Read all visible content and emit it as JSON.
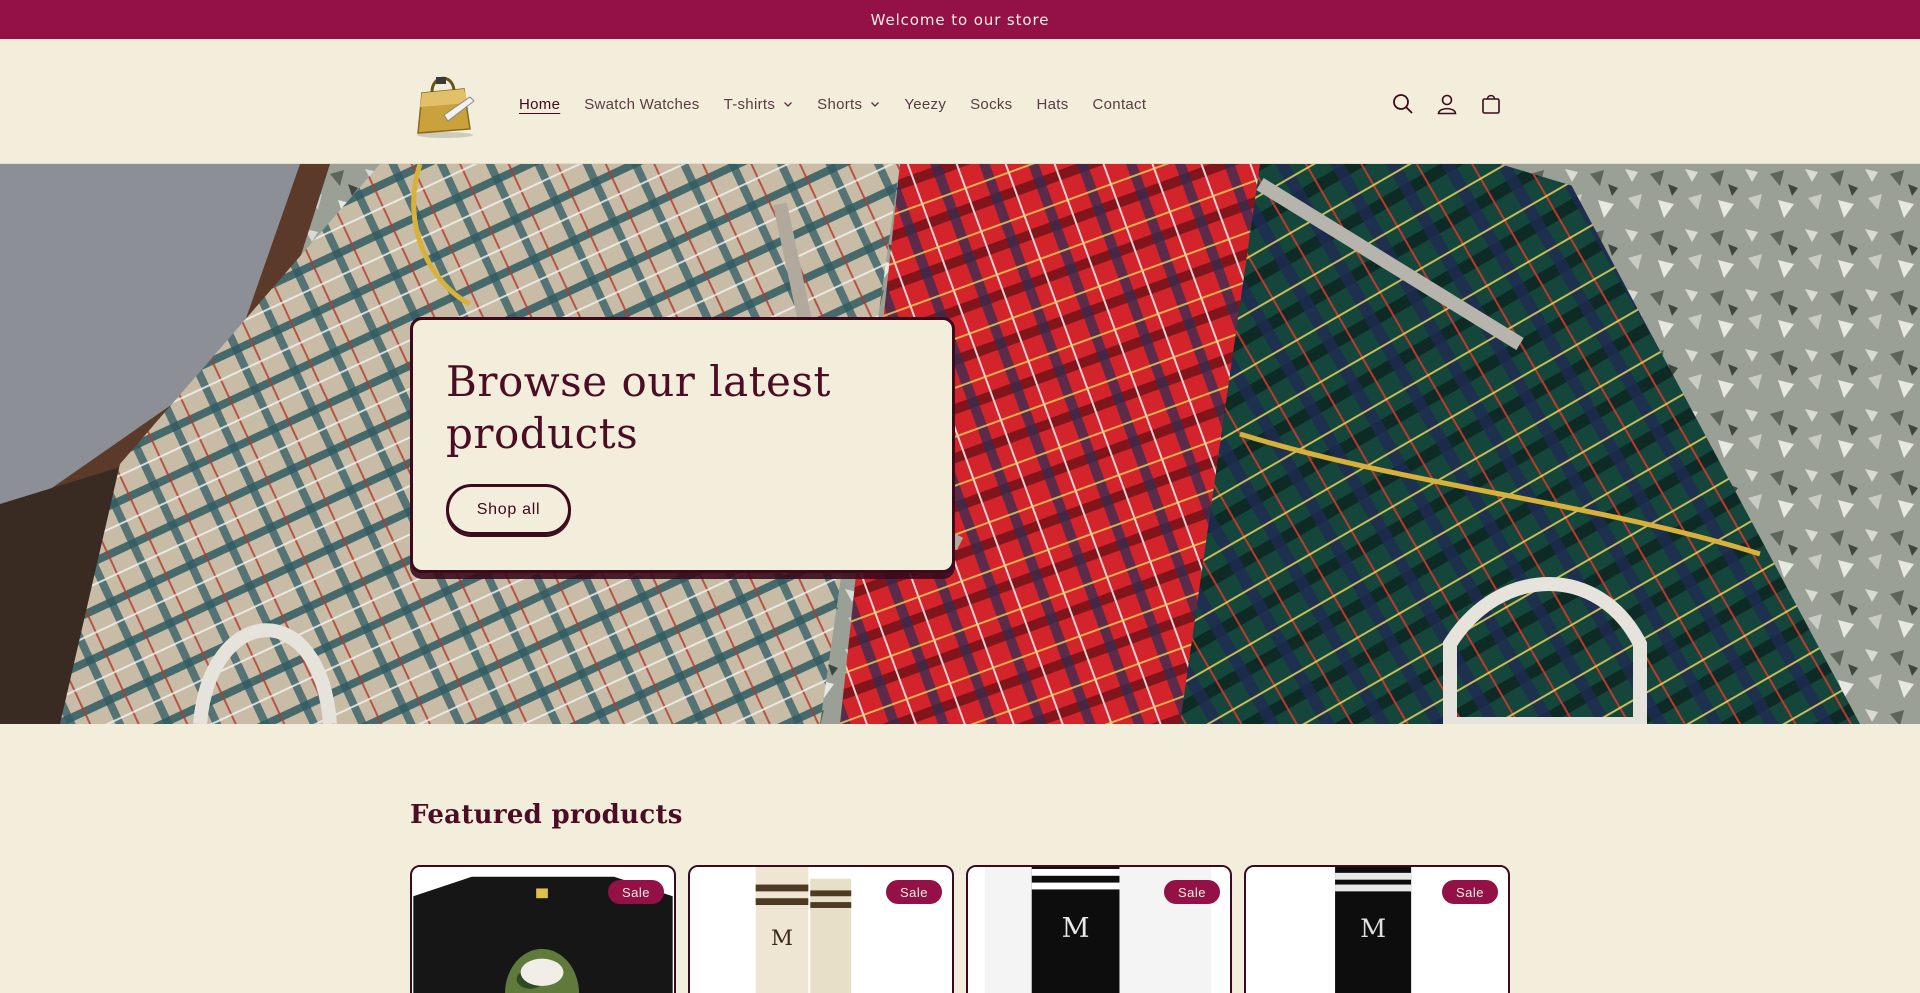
{
  "announcement": {
    "text": "Welcome to our store"
  },
  "header": {
    "nav": [
      {
        "label": "Home",
        "active": true,
        "dropdown": false
      },
      {
        "label": "Swatch Watches",
        "active": false,
        "dropdown": false
      },
      {
        "label": "T-shirts",
        "active": false,
        "dropdown": true
      },
      {
        "label": "Shorts",
        "active": false,
        "dropdown": true
      },
      {
        "label": "Yeezy",
        "active": false,
        "dropdown": false
      },
      {
        "label": "Socks",
        "active": false,
        "dropdown": false
      },
      {
        "label": "Hats",
        "active": false,
        "dropdown": false
      },
      {
        "label": "Contact",
        "active": false,
        "dropdown": false
      }
    ],
    "icons": [
      "search-icon",
      "account-icon",
      "cart-icon"
    ]
  },
  "hero": {
    "title": "Browse our latest products",
    "button_label": "Shop all"
  },
  "featured": {
    "title": "Featured products",
    "products": [
      {
        "image": "camo-ape-tshirt",
        "badge": "Sale"
      },
      {
        "image": "cream-amiri-socks",
        "badge": "Sale"
      },
      {
        "image": "black-amiri-socks",
        "badge": "Sale"
      },
      {
        "image": "black-amiri-socks-alt",
        "badge": "Sale"
      }
    ]
  },
  "colors": {
    "announcement_bg": "#931146",
    "page_bg": "#f3eedc",
    "text": "#4a0d24",
    "badge_bg": "#931146"
  }
}
